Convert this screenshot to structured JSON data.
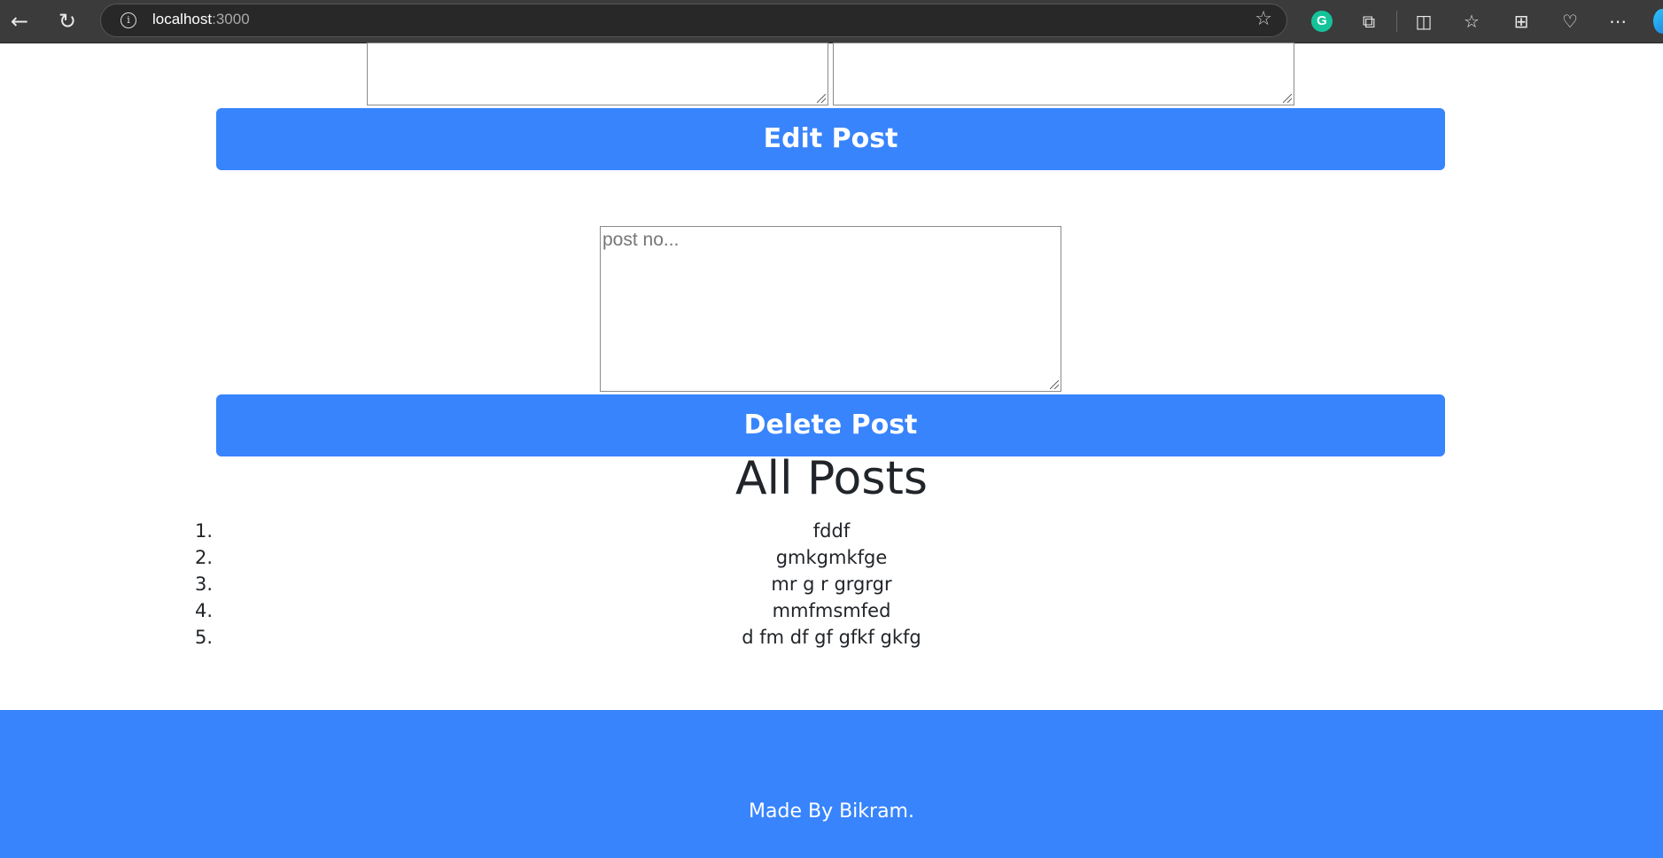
{
  "browser": {
    "url_host": "localhost",
    "url_port": ":3000"
  },
  "form": {
    "edit_button": "Edit Post",
    "post_no_placeholder": "post no...",
    "delete_button": "Delete Post"
  },
  "posts": {
    "heading": "All Posts",
    "items": [
      {
        "num": "1.",
        "text": "fddf"
      },
      {
        "num": "2.",
        "text": "gmkgmkfge"
      },
      {
        "num": "3.",
        "text": "mr g r grgrgr"
      },
      {
        "num": "4.",
        "text": "mmfmsmfed"
      },
      {
        "num": "5.",
        "text": "d fm df gf gfkf gkfg"
      }
    ]
  },
  "footer": {
    "credit": "Made By Bikram."
  },
  "colors": {
    "accent": "#3884fc",
    "chrome": "#3b3b3b"
  }
}
